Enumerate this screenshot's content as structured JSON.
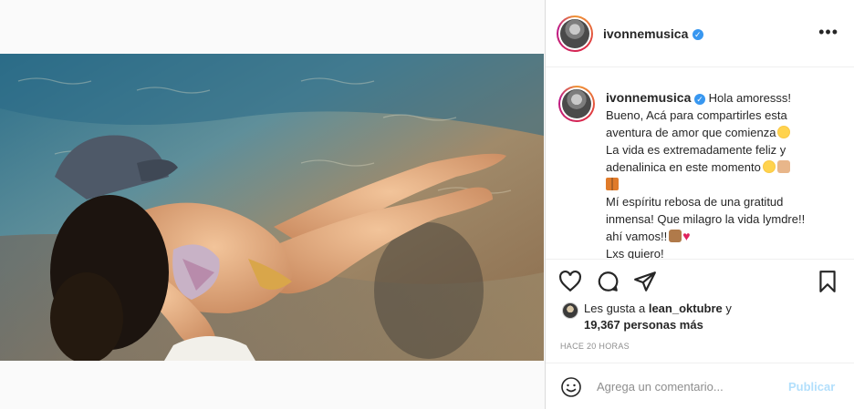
{
  "post": {
    "username": "ivonnemusica",
    "verified_badge": "verified-check-icon",
    "more_options": "•••"
  },
  "caption": {
    "username": "ivonnemusica",
    "lines": [
      "Hola amoresss!",
      "Bueno, Acá para compartirles esta",
      "aventura de amor que comienza",
      "La vida es extremadamente feliz y",
      "adenalinica en este momento",
      "",
      "Mí espíritu rebosa de una gratitud",
      "inmensa! Que milagro la vida lymdre!!",
      "ahí vamos!!",
      "Lxs quiero!"
    ],
    "emojis": [
      "smiling-face-with-heart-eyes",
      "smiling-face-with-hearts",
      "raising-hands",
      "butterfly",
      "flexed-biceps",
      "red-heart"
    ]
  },
  "actions": {
    "like_icon": "heart-outline-icon",
    "comment_icon": "speech-bubble-icon",
    "share_icon": "paper-plane-icon",
    "save_icon": "bookmark-icon"
  },
  "likes": {
    "prefix": "Les gusta a ",
    "liker": "lean_oktubre",
    "connector": " y",
    "others": "19,367 personas más"
  },
  "timestamp": "HACE 20 HORAS",
  "comment": {
    "placeholder": "Agrega un comentario...",
    "publish_label": "Publicar"
  },
  "colors": {
    "verified_blue": "#3897f0",
    "publish_disabled": "#b2dffc",
    "heart_red": "#ed4956"
  }
}
